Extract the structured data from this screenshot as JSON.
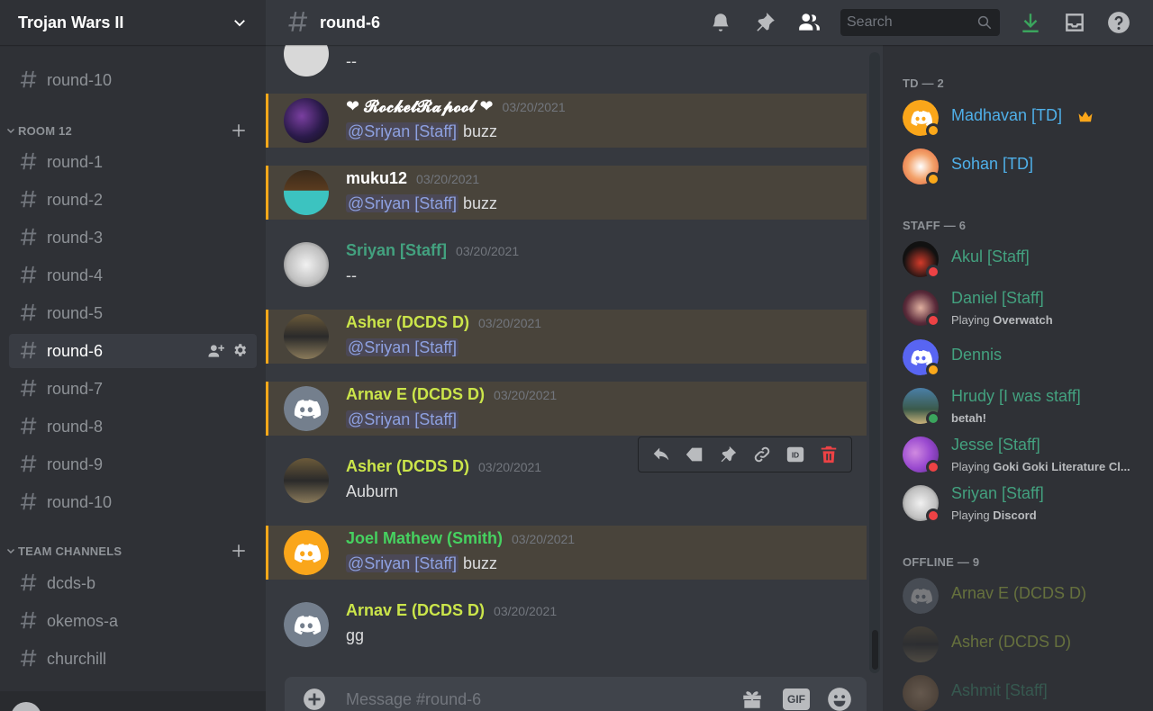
{
  "colors": {
    "td": "#4fb0e9",
    "staff": "#43a17f",
    "dcds": "#cbe54a",
    "smith": "#46d160",
    "mention_bar": "#faa81a",
    "crown": "#faa61a",
    "dnd": "#ed4245",
    "idle": "#faa81a",
    "online": "#3ba55d"
  },
  "sidebar": {
    "server_name": "Trojan Wars II",
    "top_channel": "round-10",
    "categories": [
      {
        "name": "ROOM 12",
        "channels": [
          "round-1",
          "round-2",
          "round-3",
          "round-4",
          "round-5",
          "round-6",
          "round-7",
          "round-8",
          "round-9",
          "round-10"
        ],
        "active": "round-6"
      },
      {
        "name": "TEAM CHANNELS",
        "channels": [
          "dcds-b",
          "okemos-a",
          "churchill"
        ]
      }
    ]
  },
  "header": {
    "channel": "round-6",
    "search_placeholder": "Search",
    "icons": [
      "bell-icon",
      "pin-icon",
      "members-icon",
      "search-icon",
      "download-icon",
      "inbox-icon",
      "help-icon"
    ]
  },
  "messages": [
    {
      "author": "",
      "time": "",
      "body": "--",
      "mention": false
    },
    {
      "author": "❤ 𝓡𝓸𝓬𝓴𝓮𝓽𝓡𝓪𝓹𝓸𝓸𝓵 ❤",
      "time": "03/20/2021",
      "mention_text": "@Sriyan [Staff]",
      "body": " buzz",
      "mention": true
    },
    {
      "author": "muku12",
      "time": "03/20/2021",
      "mention_text": "@Sriyan [Staff]",
      "body": " buzz",
      "mention": true
    },
    {
      "author": "Sriyan [Staff]",
      "time": "03/20/2021",
      "body": "--",
      "mention": false
    },
    {
      "author": "Asher (DCDS D)",
      "time": "03/20/2021",
      "mention_text": "@Sriyan [Staff]",
      "body": "",
      "mention": true
    },
    {
      "author": "Arnav E (DCDS D)",
      "time": "03/20/2021",
      "mention_text": "@Sriyan [Staff]",
      "body": "",
      "mention": true
    },
    {
      "author": "Asher (DCDS D)",
      "time": "03/20/2021",
      "body": "Auburn",
      "mention": false
    },
    {
      "author": "Joel Mathew (Smith)",
      "time": "03/20/2021",
      "mention_text": "@Sriyan [Staff]",
      "body": " buzz",
      "mention": true
    },
    {
      "author": "Arnav E (DCDS D)",
      "time": "03/20/2021",
      "body": "gg",
      "mention": false
    }
  ],
  "message_toolbar": {
    "icon_names": [
      "reply-icon",
      "tag-icon",
      "pin-icon",
      "link-icon",
      "id-icon",
      "delete-icon"
    ],
    "id_label": "ID"
  },
  "composer": {
    "placeholder": "Message #round-6",
    "gif_label": "GIF"
  },
  "members": {
    "groups": [
      {
        "title": "TD — 2",
        "members": [
          {
            "name": "Madhavan [TD]",
            "status": "idle",
            "crown": true
          },
          {
            "name": "Sohan [TD]",
            "status": "idle"
          }
        ]
      },
      {
        "title": "STAFF — 6",
        "members": [
          {
            "name": "Akul [Staff]",
            "status": "dnd"
          },
          {
            "name": "Daniel [Staff]",
            "status": "dnd",
            "activity_prefix": "Playing ",
            "activity": "Overwatch"
          },
          {
            "name": "Dennis",
            "status": "idle"
          },
          {
            "name": "Hrudy [I was staff]",
            "status": "online",
            "activity_prefix": "",
            "activity": "betah!"
          },
          {
            "name": "Jesse [Staff]",
            "status": "dnd",
            "activity_prefix": "Playing ",
            "activity": "Goki Goki Literature Cl..."
          },
          {
            "name": "Sriyan [Staff]",
            "status": "dnd",
            "activity_prefix": "Playing ",
            "activity": "Discord"
          }
        ]
      },
      {
        "title": "OFFLINE — 9",
        "members": [
          {
            "name": "Arnav E (DCDS D)"
          },
          {
            "name": "Asher (DCDS D)"
          },
          {
            "name": "Ashmit [Staff]"
          }
        ]
      }
    ]
  }
}
